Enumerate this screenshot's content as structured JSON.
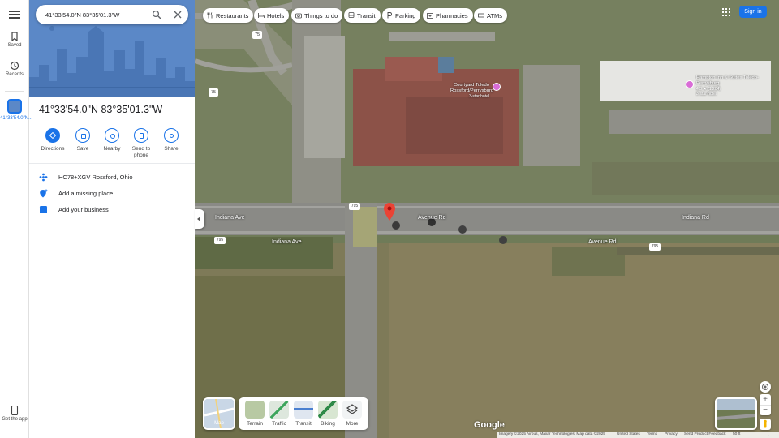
{
  "search": {
    "value": "41°33'54.0\"N 83°35'01.3\"W"
  },
  "rail": {
    "saved": "Saved",
    "recents": "Recents",
    "current_label": "41°33'54.0\"N...",
    "get_app": "Get the app"
  },
  "place": {
    "title": "41°33'54.0\"N 83°35'01.3\"W",
    "actions": [
      {
        "label": "Directions",
        "icon": "directions-icon"
      },
      {
        "label": "Save",
        "icon": "bookmark-icon"
      },
      {
        "label": "Nearby",
        "icon": "nearby-icon"
      },
      {
        "label": "Send to phone",
        "icon": "phone-icon"
      },
      {
        "label": "Share",
        "icon": "share-icon"
      }
    ],
    "plus_code": "HC78+XGV Rossford, Ohio",
    "add_place": "Add a missing place",
    "add_business": "Add your business"
  },
  "chips": [
    "Restaurants",
    "Hotels",
    "Things to do",
    "Transit",
    "Parking",
    "Pharmacies",
    "ATMs"
  ],
  "header": {
    "sign_in": "Sign in"
  },
  "map": {
    "poi_courtyard": "Courtyard Toledo Rossford/Perrysburg",
    "poi_courtyard_sub": "3-star hotel",
    "poi_hampton": "Hampton Inn & Suites Toledo-Perrysburg",
    "poi_hampton_rating": "4.3 ★ (1,204)",
    "poi_hampton_sub": "3-star hotel",
    "road_1": "Indiana Ave",
    "road_2": "Avenue Rd",
    "road_3": "Indiana Rd",
    "road_4": "Indiana Ave",
    "road_5": "Avenue Rd",
    "shield_1": "75",
    "shield_2": "75",
    "shield_3": "795",
    "shield_4": "795",
    "shield_5": "795"
  },
  "layers": {
    "main": "Map",
    "options": [
      "Terrain",
      "Traffic",
      "Transit",
      "Biking",
      "More"
    ]
  },
  "footer": {
    "imagery": "Imagery ©2025 Airbus, Maxar Technologies, Map data ©2025",
    "country": "United States",
    "terms": "Terms",
    "privacy": "Privacy",
    "feedback": "Send Product Feedback",
    "scale": "50 ft"
  },
  "logo": "Google",
  "colors": {
    "accent": "#1a73e8",
    "pin": "#ea4335",
    "hero": "#5b88c7"
  }
}
